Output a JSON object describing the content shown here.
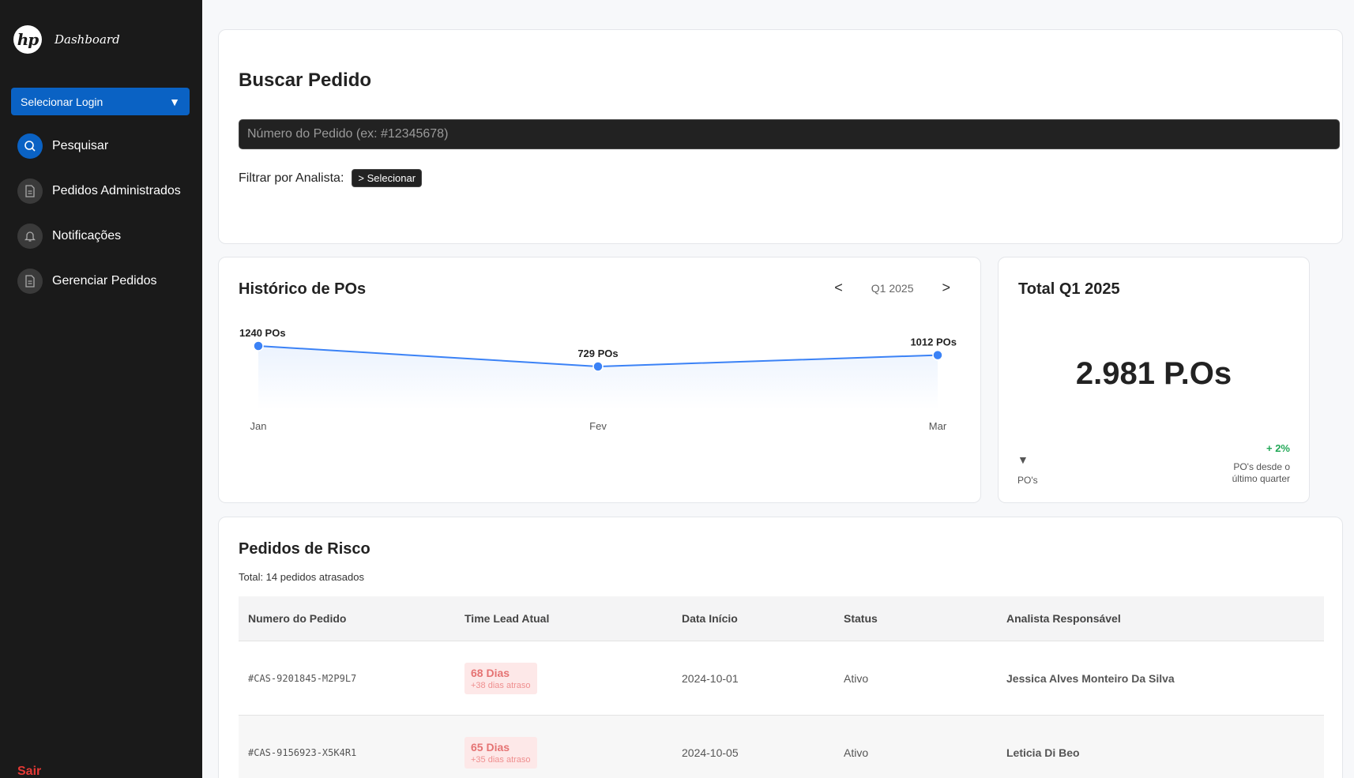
{
  "sidebar": {
    "app_title": "Dashboard",
    "logo_text": "hp",
    "login_select": "Selecionar Login",
    "items": [
      {
        "label": "Pesquisar",
        "icon": "search-icon"
      },
      {
        "label": "Pedidos Administrados",
        "icon": "document-icon"
      },
      {
        "label": "Notificações",
        "icon": "bell-icon"
      },
      {
        "label": "Gerenciar Pedidos",
        "icon": "document-icon"
      }
    ],
    "logout": "Sair"
  },
  "search": {
    "title": "Buscar Pedido",
    "placeholder": "Número do Pedido (ex: #12345678)",
    "filter_label": "Filtrar por Analista:",
    "filter_button": "> Selecionar"
  },
  "history": {
    "title": "Histórico de POs",
    "quarter": "Q1 2025",
    "prev": "<",
    "next": ">"
  },
  "chart_data": {
    "type": "line",
    "categories": [
      "Jan",
      "Fev",
      "Mar"
    ],
    "values": [
      1240,
      729,
      1012
    ],
    "data_labels": [
      "1240 POs",
      "729 POs",
      "1012 POs"
    ],
    "color": "#3b82f6"
  },
  "total": {
    "title": "Total Q1 2025",
    "value": "2.981 P.Os",
    "trend_icon": "triangle-down-icon",
    "label": "PO's",
    "change": "+ 2%",
    "change_note": "PO's desde o último quarter"
  },
  "risk": {
    "title": "Pedidos de Risco",
    "subtitle": "Total: 14 pedidos atrasados",
    "columns": [
      "Numero do Pedido",
      "Time Lead Atual",
      "Data Início",
      "Status",
      "Analista Responsável"
    ],
    "rows": [
      {
        "order": "#CAS-9201845-M2P9L7",
        "lead": "68 Dias",
        "delay": "+38 dias atraso",
        "start": "2024-10-01",
        "status": "Ativo",
        "analyst": "Jessica Alves Monteiro Da Silva"
      },
      {
        "order": "#CAS-9156923-X5K4R1",
        "lead": "65 Dias",
        "delay": "+35 dias atraso",
        "start": "2024-10-05",
        "status": "Ativo",
        "analyst": "Leticia Di Beo"
      }
    ]
  }
}
